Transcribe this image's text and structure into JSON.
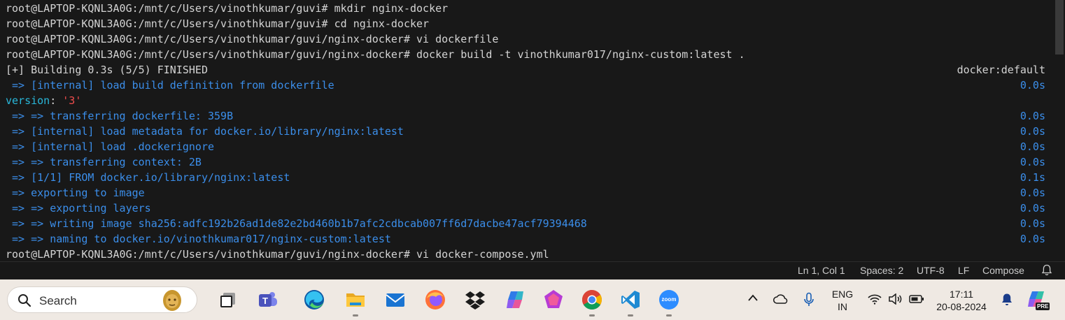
{
  "terminal": {
    "lines": [
      {
        "prompt": "root@LAPTOP-KQNL3A0G:/mnt/c/Users/vinothkumar/guvi# ",
        "command": "mkdir nginx-docker"
      },
      {
        "prompt": "root@LAPTOP-KQNL3A0G:/mnt/c/Users/vinothkumar/guvi# ",
        "command": "cd nginx-docker"
      },
      {
        "prompt": "root@LAPTOP-KQNL3A0G:/mnt/c/Users/vinothkumar/guvi/nginx-docker# ",
        "command": "vi dockerfile"
      },
      {
        "prompt": "root@LAPTOP-KQNL3A0G:/mnt/c/Users/vinothkumar/guvi/nginx-docker# ",
        "command": "docker build -t vinothkumar017/nginx-custom:latest ."
      },
      {
        "text": "[+] Building 0.3s (5/5) FINISHED",
        "duration": "docker:default"
      },
      {
        "text": " => [internal] load build definition from dockerfile",
        "duration": "0.0s"
      },
      {
        "key": "version",
        "sep": ": ",
        "value": "'3'"
      },
      {
        "text": " => => transferring dockerfile: 359B",
        "duration": "0.0s"
      },
      {
        "text": " => [internal] load metadata for docker.io/library/nginx:latest",
        "duration": "0.0s"
      },
      {
        "text": " => [internal] load .dockerignore",
        "duration": "0.0s"
      },
      {
        "text": " => => transferring context: 2B",
        "duration": "0.0s"
      },
      {
        "text": " => [1/1] FROM docker.io/library/nginx:latest",
        "duration": "0.1s"
      },
      {
        "text": " => exporting to image",
        "duration": "0.0s"
      },
      {
        "text": " => => exporting layers",
        "duration": "0.0s"
      },
      {
        "text": " => => writing image sha256:adfc192b26ad1de82e2bd460b1b7afc2cdbcab007ff6d7dacbe47acf79394468",
        "duration": "0.0s"
      },
      {
        "text": " => => naming to docker.io/vinothkumar017/nginx-custom:latest",
        "duration": "0.0s"
      },
      {
        "prompt": "root@LAPTOP-KQNL3A0G:/mnt/c/Users/vinothkumar/guvi/nginx-docker# ",
        "command": "vi docker-compose.yml"
      }
    ]
  },
  "statusbar": {
    "position": "Ln 1, Col 1",
    "spaces": "Spaces: 2",
    "encoding": "UTF-8",
    "eol": "LF",
    "language": "Compose"
  },
  "taskbar": {
    "search_label": "Search",
    "apps": [
      {
        "name": "task-view-icon"
      },
      {
        "name": "teams-icon"
      },
      {
        "name": "edge-icon"
      },
      {
        "name": "file-explorer-icon"
      },
      {
        "name": "mail-icon"
      },
      {
        "name": "firefox-icon"
      },
      {
        "name": "dropbox-icon"
      },
      {
        "name": "copilot-app-icon"
      },
      {
        "name": "clipchamp-icon"
      },
      {
        "name": "chrome-icon"
      },
      {
        "name": "vscode-icon"
      },
      {
        "name": "zoom-icon",
        "text": "zoom"
      }
    ],
    "tray": {
      "lang_top": "ENG",
      "lang_bottom": "IN",
      "time": "17:11",
      "date": "20-08-2024",
      "copilot_badge": "PRE"
    }
  },
  "colors": {
    "terminal_bg": "#181818",
    "terminal_fg": "#d4d4d4",
    "blue": "#3b8eea",
    "cyan": "#29b8db",
    "red": "#f14c4c",
    "taskbar_bg": "#efe9e3"
  }
}
